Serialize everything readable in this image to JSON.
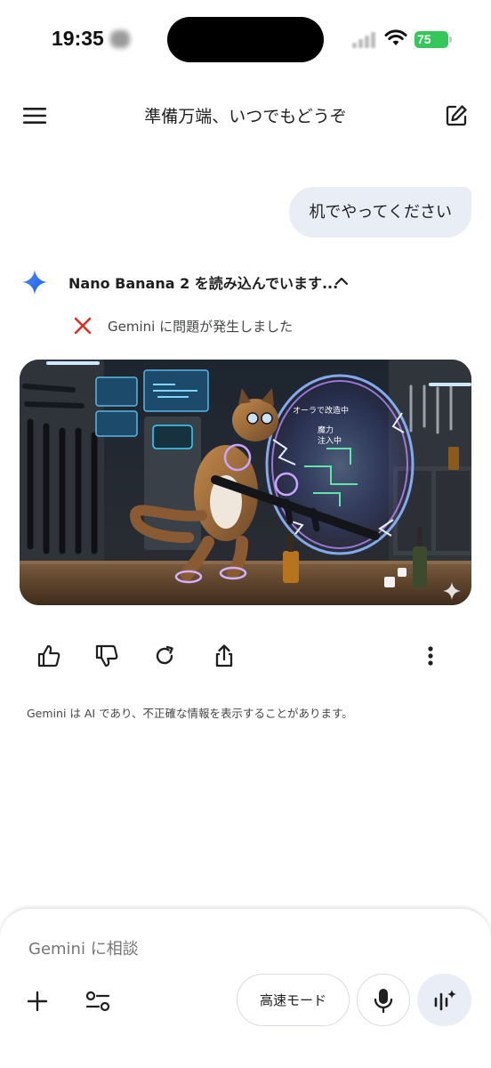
{
  "status_bar": {
    "time": "19:35",
    "battery": "75"
  },
  "header": {
    "title": "準備万端、いつでもどうぞ"
  },
  "conversation": {
    "user_message": "机でやってください",
    "loading_status": "Nano Banana 2 を読み込んでいます...",
    "error_message": "Gemini に問題が発生しました",
    "image_overlay_texts": [
      "オーラで改造中",
      "魔力",
      "注入中"
    ],
    "disclaimer": "Gemini は AI であり、不正確な情報を表示することがあります。"
  },
  "composer": {
    "placeholder": "Gemini に相談",
    "mode_label": "高速モード"
  },
  "colors": {
    "accent_blue": "#4285f4",
    "error_red": "#d93025",
    "battery_green": "#34c759",
    "bubble_bg": "#e9eef6"
  },
  "icons": [
    "menu-icon",
    "edit-icon",
    "gemini-spark-icon",
    "chevron-up-icon",
    "error-x-icon",
    "thumbs-up-icon",
    "thumbs-down-icon",
    "regenerate-icon",
    "share-icon",
    "more-vert-icon",
    "plus-icon",
    "tools-icon",
    "mic-icon",
    "live-icon"
  ]
}
